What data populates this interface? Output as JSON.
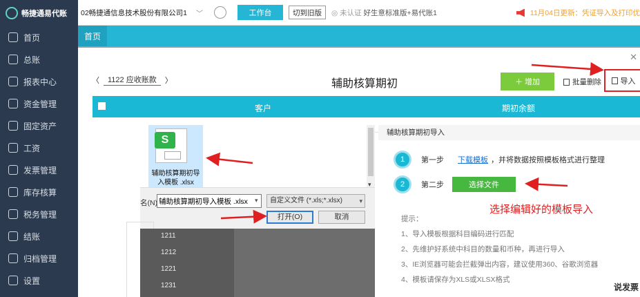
{
  "sidebar": {
    "logo": "畅捷通易代账",
    "items": [
      {
        "label": "首页",
        "icon": "home-icon"
      },
      {
        "label": "总账",
        "icon": "ledger-icon"
      },
      {
        "label": "报表中心",
        "icon": "chart-icon"
      },
      {
        "label": "资金管理",
        "icon": "wallet-icon"
      },
      {
        "label": "固定资产",
        "icon": "asset-icon"
      },
      {
        "label": "工资",
        "icon": "salary-icon"
      },
      {
        "label": "发票管理",
        "icon": "invoice-icon"
      },
      {
        "label": "库存核算",
        "icon": "warehouse-icon"
      },
      {
        "label": "税务管理",
        "icon": "tax-icon"
      },
      {
        "label": "结账",
        "icon": "close-books-icon"
      },
      {
        "label": "归档管理",
        "icon": "archive-icon"
      },
      {
        "label": "设置",
        "icon": "settings-icon"
      }
    ]
  },
  "topbar": {
    "company": "02畅捷通信息技术股份有限公司1",
    "workbench": "工作台",
    "switch_old": "切到旧版",
    "cert_status": "未认证",
    "edition": "好生意标准版+易代账1",
    "notice": "11月04日更新：凭证导入及打印优"
  },
  "tabs": {
    "home": "首页"
  },
  "page": {
    "subject_code": "1122",
    "subject_name": "应收账款",
    "title": "辅助核算期初",
    "add_btn": "增加",
    "batch_delete": "批量删除",
    "import_btn": "导入",
    "col_customer": "客户",
    "col_balance": "期初余额"
  },
  "file_dialog": {
    "file_label": "辅助核算期初导入模板 .xlsx",
    "name_label": "名(N):",
    "file_name_value": "辅助核算期初导入模板 .xlsx",
    "file_type": "自定义文件 (*.xls;*.xlsx)",
    "open_btn": "打开(O)",
    "cancel_btn": "取消",
    "list_numbers": [
      "1211",
      "1212",
      "1221",
      "1231"
    ]
  },
  "import_panel": {
    "title": "辅助核算期初导入",
    "step1_num": "1",
    "step1_label": "第一步",
    "download_link": "下载模板",
    "step1_text": "，并将数据按照模板格式进行整理",
    "step2_num": "2",
    "step2_label": "第二步",
    "choose_file": "选择文件",
    "hint": "选择编辑好的模板导入",
    "tips_title": "提示：",
    "tips": [
      "1、导入模板根据科目编码进行匹配",
      "2、先维护好系统中科目的数量和币种，再进行导入",
      "3、IE浏览器可能会拦截弹出内容，建议使用360、谷歌浏览器",
      "4、模板请保存为XLS或XLSX格式"
    ],
    "cut_text": "说发票"
  },
  "colors": {
    "accent": "#25b6d5",
    "green": "#7ccb3c",
    "red": "#e02020",
    "sidebar": "#2b3a4e"
  }
}
